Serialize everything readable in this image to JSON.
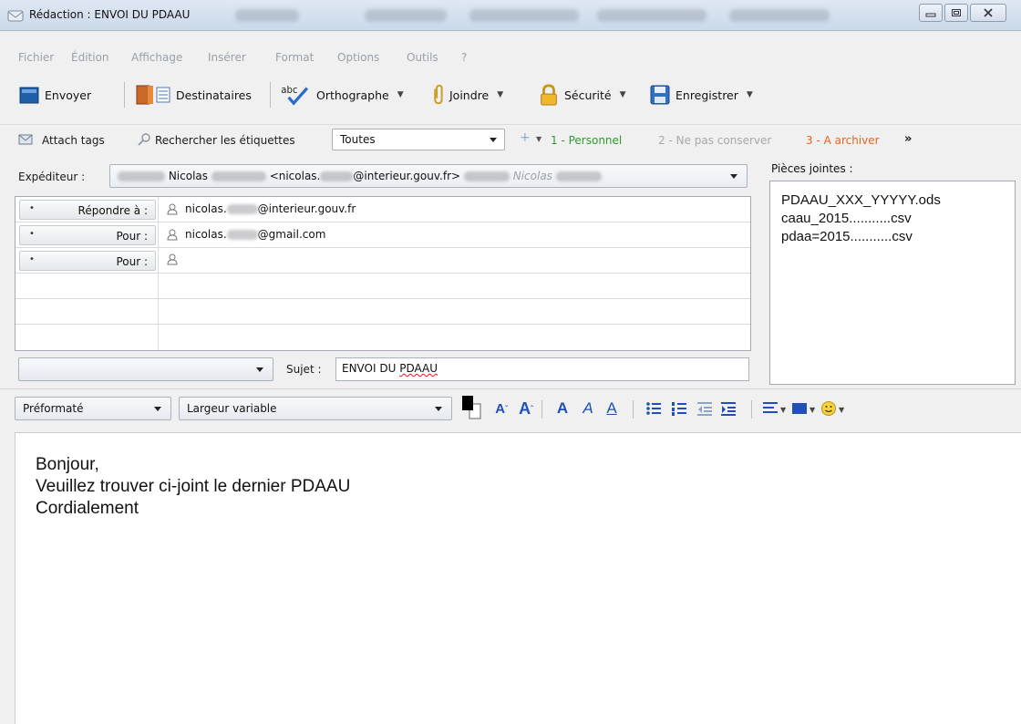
{
  "window": {
    "title": "Rédaction : ENVOI DU PDAAU"
  },
  "menu": {
    "items": [
      "Fichier",
      "Édition",
      "Affichage",
      "Insérer",
      "Format",
      "Options",
      "Outils",
      "?"
    ]
  },
  "toolbar": {
    "send": "Envoyer",
    "contacts": "Destinataires",
    "spell": "Orthographe",
    "attach": "Joindre",
    "security": "Sécurité",
    "save": "Enregistrer",
    "spell_icon_text": "abc"
  },
  "tags": {
    "attach_tags": "Attach tags",
    "search_tags": "Rechercher les étiquettes",
    "filter_value": "Toutes",
    "tag1": "1 - Personnel",
    "tag2": "2 - Ne pas conserver",
    "tag3": "3 - A archiver",
    "more": "»",
    "tag1_color": "#2e9a2e",
    "tag2_color": "#a8a8a8",
    "tag3_color": "#e8641e"
  },
  "header": {
    "sender_label": "Expéditeur :",
    "sender_name": "Nicolas",
    "sender_email_start": "<nicolas.",
    "sender_email_end": "@interieur.gouv.fr>",
    "sender_identity": "Nicolas",
    "recipients": [
      {
        "type": "Répondre à :",
        "address_start": "nicolas.",
        "address_end": "@interieur.gouv.fr"
      },
      {
        "type": "Pour :",
        "address_start": "nicolas.",
        "address_end": "@gmail.com"
      },
      {
        "type": "Pour :",
        "address_start": "",
        "address_end": ""
      }
    ],
    "subject_label": "Sujet :",
    "subject_prefix": "ENVOI DU ",
    "subject_word": "PDAAU"
  },
  "attachments": {
    "title": "Pièces jointes :",
    "items": [
      "PDAAU_XXX_YYYYY.ods",
      "caau_2015...........csv",
      "pdaa=2015...........csv"
    ]
  },
  "format": {
    "paragraph_style": "Préformaté",
    "font": "Largeur variable"
  },
  "body": {
    "lines": [
      "Bonjour,",
      "Veuillez trouver ci-joint le dernier PDAAU",
      "Cordialement"
    ]
  }
}
